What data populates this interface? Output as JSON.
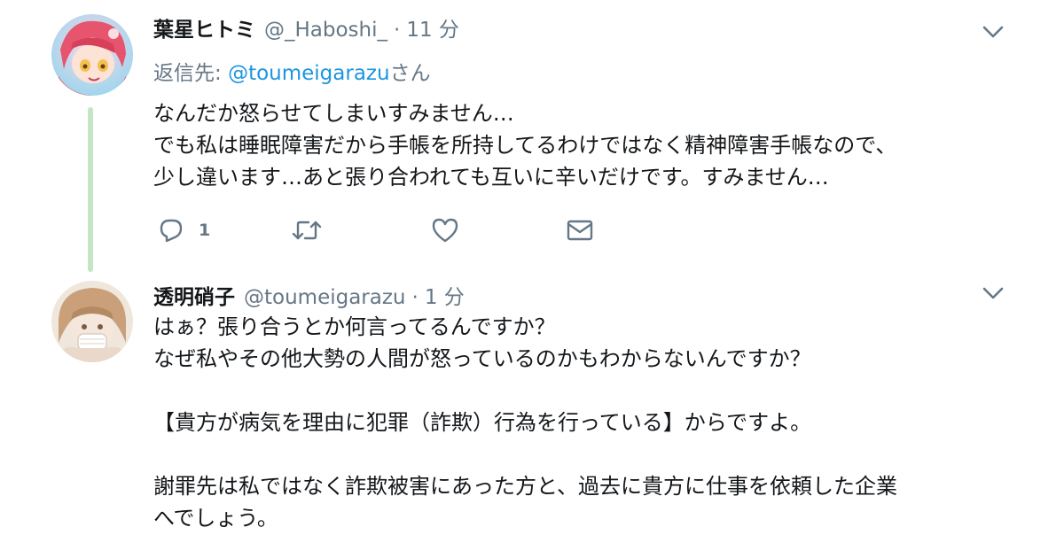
{
  "colors": {
    "accent": "#1b95e0",
    "secondary_text": "#657786",
    "primary_text": "#14171a",
    "thread_line": "#c4e6c4"
  },
  "tweets": [
    {
      "author": {
        "display_name": "葉星ヒトミ",
        "handle": "@_Haboshi_",
        "separator": "·",
        "time": "11 分"
      },
      "reply_to": {
        "label": "返信先: ",
        "mention": "@toumeigarazu",
        "suffix": "さん"
      },
      "text_lines": [
        "なんだか怒らせてしまいすみません…",
        "でも私は睡眠障害だから手帳を所持してるわけではなく精神障害手帳なので、",
        "少し違います…あと張り合われても互いに辛いだけです。すみません…"
      ],
      "actions": {
        "reply_icon": "reply-icon",
        "reply_count": "1",
        "retweet_icon": "retweet-icon",
        "like_icon": "heart-icon",
        "dm_icon": "envelope-icon"
      },
      "menu_icon": "chevron-down-icon"
    },
    {
      "author": {
        "display_name": "透明硝子",
        "handle": "@toumeigarazu",
        "separator": "·",
        "time": "1 分"
      },
      "text_lines": [
        "はぁ？張り合うとか何言ってるんですか？",
        "なぜ私やその他大勢の人間が怒っているのかもわからないんですか？",
        "",
        "【貴方が病気を理由に犯罪（詐欺）行為を行っている】からですよ。",
        "",
        "謝罪先は私ではなく詐欺被害にあった方と、過去に貴方に仕事を依頼した企業",
        "へでしょう。"
      ],
      "menu_icon": "chevron-down-icon"
    }
  ]
}
